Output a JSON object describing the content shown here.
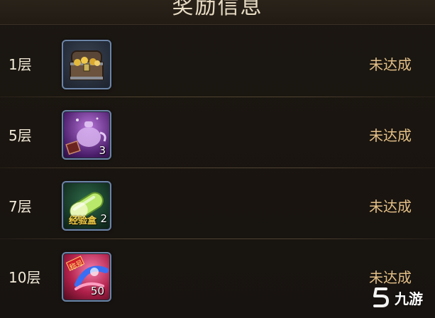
{
  "header": {
    "title": "奖励信息"
  },
  "rewards": [
    {
      "floor": "1层",
      "item_icon": "treasure-chest-icon",
      "count": "",
      "status": "未达成"
    },
    {
      "floor": "5层",
      "item_icon": "purple-teapot-icon",
      "count": "3",
      "status": "未达成"
    },
    {
      "floor": "7层",
      "item_icon": "experience-pill-icon",
      "count": "2",
      "item_label": "经验盒",
      "status": "未达成"
    },
    {
      "floor": "10层",
      "item_icon": "red-orb-icon",
      "count": "50",
      "item_label": "称号",
      "status": "未达成"
    }
  ],
  "watermark": {
    "logo_icon": "jiuyou-logo-icon",
    "text": "九游"
  },
  "colors": {
    "status_text": "#e3bf86",
    "floor_text": "#f2ead8",
    "icon_border": "#6c84a6",
    "background": "#17130f"
  }
}
